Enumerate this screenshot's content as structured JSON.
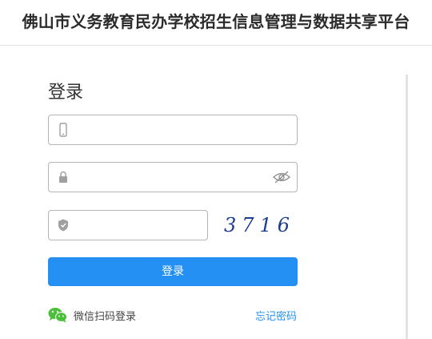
{
  "header": {
    "title": "佛山市义务教育民办学校招生信息管理与数据共享平台"
  },
  "login": {
    "title": "登录",
    "phone": {
      "value": "",
      "placeholder": "",
      "icon": "phone-icon"
    },
    "password": {
      "value": "",
      "placeholder": "",
      "icon": "lock-icon",
      "toggle_icon": "eye-hidden-icon"
    },
    "captcha": {
      "value": "",
      "placeholder": "",
      "icon": "shield-icon",
      "code": "3716"
    },
    "submit_label": "登录",
    "wechat_label": "微信扫码登录",
    "forgot_label": "忘记密码"
  },
  "colors": {
    "primary": "#2590f3",
    "captcha_text": "#1d3e8c",
    "wechat_green": "#4cbf3a"
  }
}
